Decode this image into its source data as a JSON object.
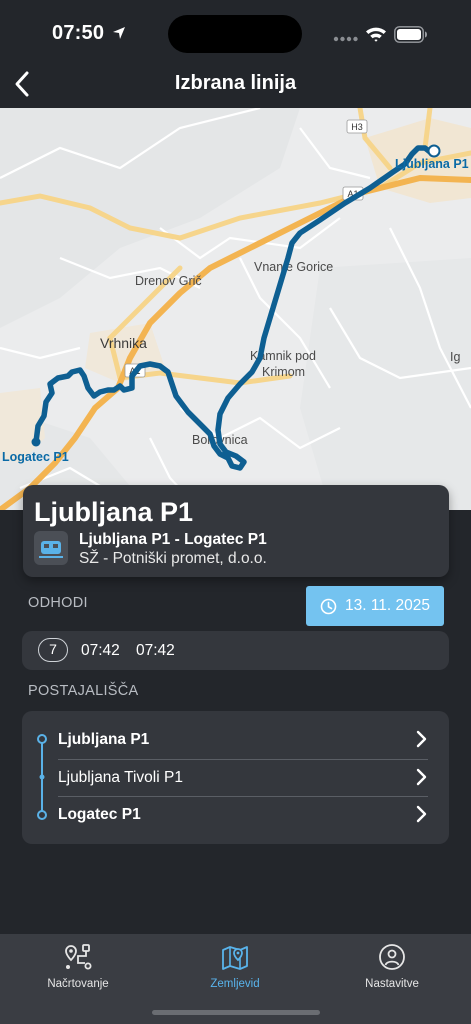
{
  "status_bar": {
    "time": "07:50"
  },
  "header": {
    "title": "Izbrana linija"
  },
  "map": {
    "labels": {
      "drenov_gric": "Drenov Grič",
      "vnanje_gorice": "Vnanje Gorice",
      "vrhnika": "Vrhnika",
      "kamnik_pod_krimom_1": "Kamnik pod",
      "kamnik_pod_krimom_2": "Krimom",
      "borovnica": "Borovnica",
      "ig": "Ig",
      "road_h3": "H3",
      "road_a1_north": "A1",
      "road_a1_vrhnika": "A1"
    },
    "stop_labels": {
      "start": "Ljubljana P1",
      "end": "Logatec P1"
    },
    "route_color": "#0e5f92"
  },
  "line_card": {
    "title": "Ljubljana P1",
    "route": "Ljubljana P1 - Logatec P1",
    "operator": "SŽ - Potniški promet, d.o.o."
  },
  "departures": {
    "heading": "ODHODI",
    "date": "13. 11. 2025",
    "count": "7",
    "times": [
      "07:42",
      "07:42"
    ]
  },
  "stops": {
    "heading": "POSTAJALIŠČA",
    "items": [
      {
        "label": "Ljubljana P1",
        "bold": true
      },
      {
        "label": "Ljubljana Tivoli P1",
        "bold": false
      },
      {
        "label": "Logatec P1",
        "bold": true
      }
    ]
  },
  "tabbar": {
    "tabs": [
      {
        "label": "Načrtovanje",
        "icon": "route-planning-icon",
        "active": false
      },
      {
        "label": "Zemljevid",
        "icon": "map-icon",
        "active": true
      },
      {
        "label": "Nastavitve",
        "icon": "settings-user-icon",
        "active": false
      }
    ]
  },
  "colors": {
    "accent": "#74c3f0",
    "active_tab": "#59b4ec",
    "background": "#23262b",
    "card": "#34373d"
  }
}
